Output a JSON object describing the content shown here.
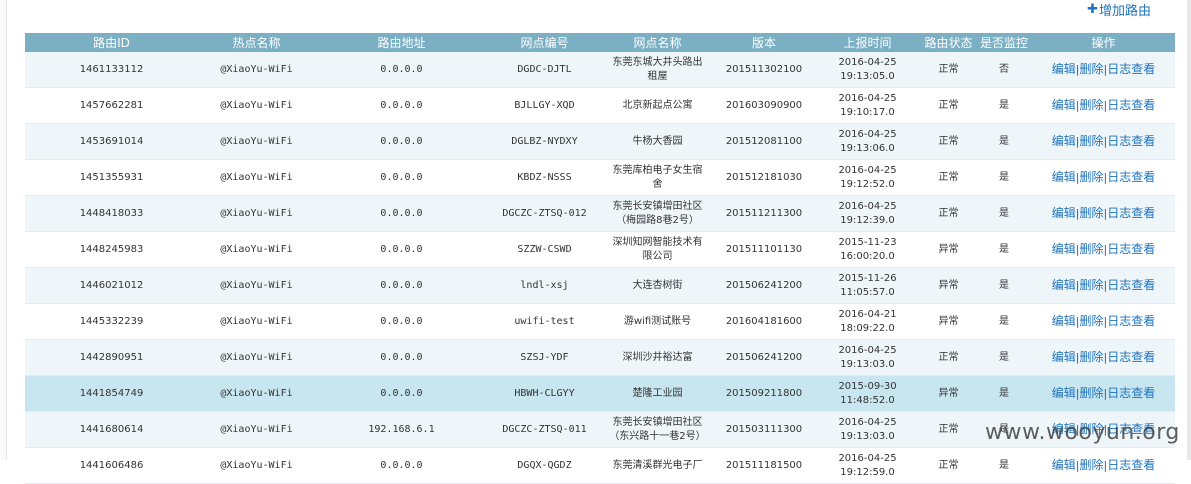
{
  "toolbar": {
    "add_label": "增加路由",
    "add_icon": "plus-icon"
  },
  "table": {
    "columns": [
      "路由ID",
      "热点名称",
      "路由地址",
      "网点编号",
      "网点名称",
      "版本",
      "上报时间",
      "路由状态",
      "是否监控",
      "操作"
    ],
    "ops": {
      "edit": "编辑",
      "delete": "删除",
      "log": "日志查看",
      "sep": "|"
    },
    "rows": [
      {
        "id": "1461133112",
        "ssid": "@XiaoYu-WiFi",
        "addr": "0.0.0.0",
        "code": "DGDC-DJTL",
        "name_l1": "东莞东城大井头路出",
        "name_l2": "租屋",
        "ver": "201511302100",
        "date": "2016-04-25",
        "time": "19:13:05.0",
        "status": "正常",
        "monitor": "否"
      },
      {
        "id": "1457662281",
        "ssid": "@XiaoYu-WiFi",
        "addr": "0.0.0.0",
        "code": "BJLLGY-XQD",
        "name_l1": "北京新起点公寓",
        "name_l2": "",
        "ver": "201603090900",
        "date": "2016-04-25",
        "time": "19:10:17.0",
        "status": "正常",
        "monitor": "是"
      },
      {
        "id": "1453691014",
        "ssid": "@XiaoYu-WiFi",
        "addr": "0.0.0.0",
        "code": "DGLBZ-NYDXY",
        "name_l1": "牛杨大香园",
        "name_l2": "",
        "ver": "201512081100",
        "date": "2016-04-25",
        "time": "19:13:06.0",
        "status": "正常",
        "monitor": "是"
      },
      {
        "id": "1451355931",
        "ssid": "@XiaoYu-WiFi",
        "addr": "0.0.0.0",
        "code": "KBDZ-NSSS",
        "name_l1": "东莞库柏电子女生宿",
        "name_l2": "舍",
        "ver": "201512181030",
        "date": "2016-04-25",
        "time": "19:12:52.0",
        "status": "正常",
        "monitor": "是"
      },
      {
        "id": "1448418033",
        "ssid": "@XiaoYu-WiFi",
        "addr": "0.0.0.0",
        "code": "DGCZC-ZTSQ-012",
        "name_l1": "东莞长安镇增田社区",
        "name_l2": "（梅园路8巷2号）",
        "ver": "201511211300",
        "date": "2016-04-25",
        "time": "19:12:39.0",
        "status": "正常",
        "monitor": "是"
      },
      {
        "id": "1448245983",
        "ssid": "@XiaoYu-WiFi",
        "addr": "0.0.0.0",
        "code": "SZZW-CSWD",
        "name_l1": "深圳知网智能技术有",
        "name_l2": "限公司",
        "ver": "201511101130",
        "date": "2015-11-23",
        "time": "16:00:20.0",
        "status": "异常",
        "monitor": "是"
      },
      {
        "id": "1446021012",
        "ssid": "@XiaoYu-WiFi",
        "addr": "0.0.0.0",
        "code": "lndl-xsj",
        "name_l1": "大连杏树街",
        "name_l2": "",
        "ver": "201506241200",
        "date": "2015-11-26",
        "time": "11:05:57.0",
        "status": "异常",
        "monitor": "是"
      },
      {
        "id": "1445332239",
        "ssid": "@XiaoYu-WiFi",
        "addr": "0.0.0.0",
        "code": "uwifi-test",
        "name_l1": "游wifi测试账号",
        "name_l2": "",
        "ver": "201604181600",
        "date": "2016-04-21",
        "time": "18:09:22.0",
        "status": "异常",
        "monitor": "是"
      },
      {
        "id": "1442890951",
        "ssid": "@XiaoYu-WiFi",
        "addr": "0.0.0.0",
        "code": "SZSJ-YDF",
        "name_l1": "深圳沙井裕达富",
        "name_l2": "",
        "ver": "201506241200",
        "date": "2016-04-25",
        "time": "19:13:03.0",
        "status": "正常",
        "monitor": "是"
      },
      {
        "id": "1441854749",
        "ssid": "@XiaoYu-WiFi",
        "addr": "0.0.0.0",
        "code": "HBWH-CLGYY",
        "name_l1": "楚隆工业园",
        "name_l2": "",
        "ver": "201509211800",
        "date": "2015-09-30",
        "time": "11:48:52.0",
        "status": "异常",
        "monitor": "是"
      },
      {
        "id": "1441680614",
        "ssid": "@XiaoYu-WiFi",
        "addr": "192.168.6.1",
        "code": "DGCZC-ZTSQ-011",
        "name_l1": "东莞长安镇增田社区",
        "name_l2": "（东兴路十一巷2号）",
        "ver": "201503111300",
        "date": "2016-04-25",
        "time": "19:13:03.0",
        "status": "正常",
        "monitor": "是"
      },
      {
        "id": "1441606486",
        "ssid": "@XiaoYu-WiFi",
        "addr": "0.0.0.0",
        "code": "DGQX-QGDZ",
        "name_l1": "东莞清溪群光电子厂",
        "name_l2": "",
        "ver": "201511181500",
        "date": "2016-04-25",
        "time": "19:12:59.0",
        "status": "正常",
        "monitor": "是"
      }
    ]
  },
  "watermark": "www.wooyun.org"
}
